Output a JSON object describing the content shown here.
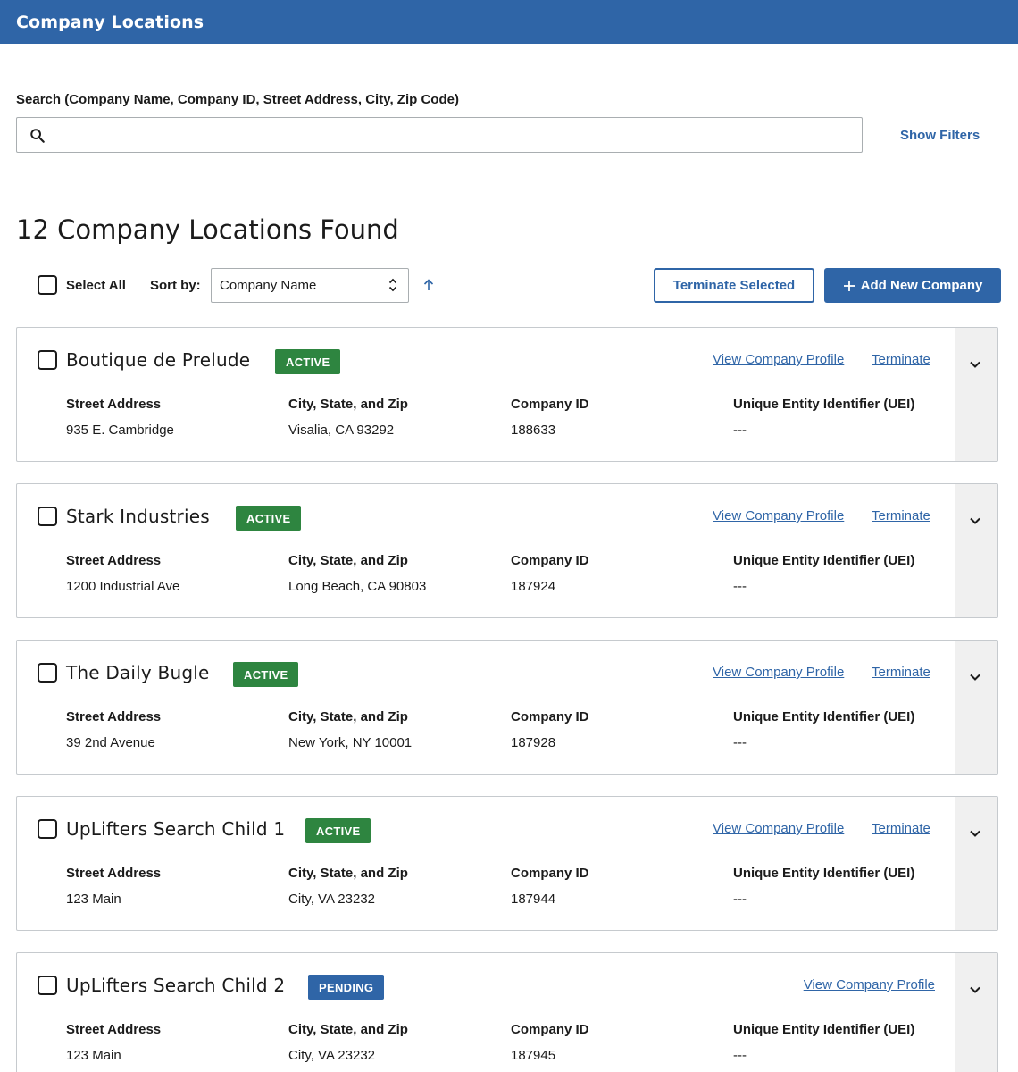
{
  "header": {
    "title": "Company Locations"
  },
  "search": {
    "label": "Search (Company Name, Company ID, Street Address, City, Zip Code)",
    "value": "",
    "placeholder": "",
    "show_filters_label": "Show Filters"
  },
  "results": {
    "count_label": "12 Company Locations Found"
  },
  "toolbar": {
    "select_all_label": "Select All",
    "sort_by_label": "Sort by:",
    "sort_value": "Company Name",
    "sort_direction": "ascending",
    "terminate_selected_label": "Terminate Selected",
    "add_new_label": "Add New Company"
  },
  "field_labels": {
    "street": "Street Address",
    "city": "City, State, and Zip",
    "company_id": "Company ID",
    "uei": "Unique Entity Identifier (UEI)"
  },
  "link_labels": {
    "view_profile": "View Company Profile",
    "terminate": "Terminate"
  },
  "colors": {
    "primary": "#2f65a7",
    "active": "#2e8540",
    "pending": "#2f65a7"
  },
  "companies": [
    {
      "name": "Boutique de Prelude",
      "status": "ACTIVE",
      "street": "935 E. Cambridge",
      "city": "Visalia, CA 93292",
      "company_id": "188633",
      "uei": "---"
    },
    {
      "name": "Stark Industries",
      "status": "ACTIVE",
      "street": "1200 Industrial Ave",
      "city": "Long Beach, CA 90803",
      "company_id": "187924",
      "uei": "---"
    },
    {
      "name": "The Daily Bugle",
      "status": "ACTIVE",
      "street": "39 2nd Avenue",
      "city": "New York, NY 10001",
      "company_id": "187928",
      "uei": "---"
    },
    {
      "name": "UpLifters Search Child 1",
      "status": "ACTIVE",
      "street": "123 Main",
      "city": "City, VA 23232",
      "company_id": "187944",
      "uei": "---"
    },
    {
      "name": "UpLifters Search Child 2",
      "status": "PENDING",
      "street": "123 Main",
      "city": "City, VA 23232",
      "company_id": "187945",
      "uei": "---"
    }
  ]
}
